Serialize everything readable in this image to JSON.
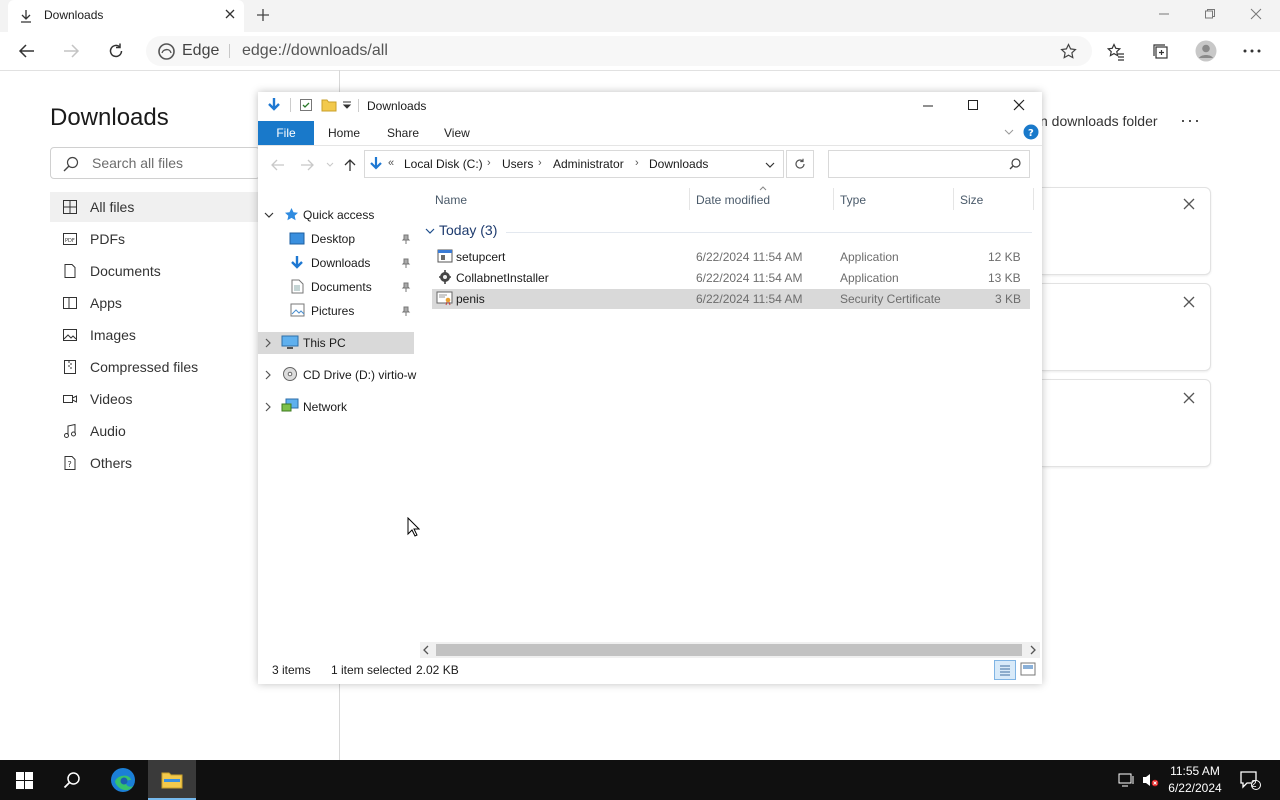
{
  "browser": {
    "tab_title": "Downloads",
    "address_prefix": "Edge",
    "address_url": "edge://downloads/all"
  },
  "downloads_page": {
    "title": "Downloads",
    "search_placeholder": "Search all files",
    "nav": [
      {
        "label": "All files",
        "icon": "grid-icon"
      },
      {
        "label": "PDFs",
        "icon": "pdf-icon"
      },
      {
        "label": "Documents",
        "icon": "document-icon"
      },
      {
        "label": "Apps",
        "icon": "apps-icon"
      },
      {
        "label": "Images",
        "icon": "image-icon"
      },
      {
        "label": "Compressed files",
        "icon": "zip-icon"
      },
      {
        "label": "Videos",
        "icon": "video-icon"
      },
      {
        "label": "Audio",
        "icon": "audio-icon"
      },
      {
        "label": "Others",
        "icon": "other-file-icon"
      }
    ],
    "open_folder_label": "n downloads folder",
    "more_label": "···"
  },
  "explorer": {
    "title": "Downloads",
    "ribbon_tabs": {
      "file": "File",
      "home": "Home",
      "share": "Share",
      "view": "View"
    },
    "breadcrumb": {
      "prefix": "«",
      "items": [
        "Local Disk (C:)",
        "Users",
        "Administrator",
        "Downloads"
      ]
    },
    "tree": {
      "quick_access": "Quick access",
      "desktop": "Desktop",
      "downloads": "Downloads",
      "documents": "Documents",
      "pictures": "Pictures",
      "this_pc": "This PC",
      "cd_drive": "CD Drive (D:) virtio-w",
      "network": "Network"
    },
    "columns": {
      "name": "Name",
      "date": "Date modified",
      "type": "Type",
      "size": "Size"
    },
    "group_label": "Today (3)",
    "files": [
      {
        "name": "setupcert",
        "date": "6/22/2024 11:54 AM",
        "type": "Application",
        "size": "12 KB"
      },
      {
        "name": "CollabnetInstaller",
        "date": "6/22/2024 11:54 AM",
        "type": "Application",
        "size": "13 KB"
      },
      {
        "name": "penis",
        "date": "6/22/2024 11:54 AM",
        "type": "Security Certificate",
        "size": "3 KB"
      }
    ],
    "status": {
      "items": "3 items",
      "selected": "1 item selected",
      "size": "2.02 KB"
    }
  },
  "taskbar": {
    "time": "11:55 AM",
    "date": "6/22/2024",
    "notification_count": "2"
  },
  "colors": {
    "accent": "#1979ca",
    "edge_blue": "#0f6cbd",
    "taskbar": "#101010"
  }
}
